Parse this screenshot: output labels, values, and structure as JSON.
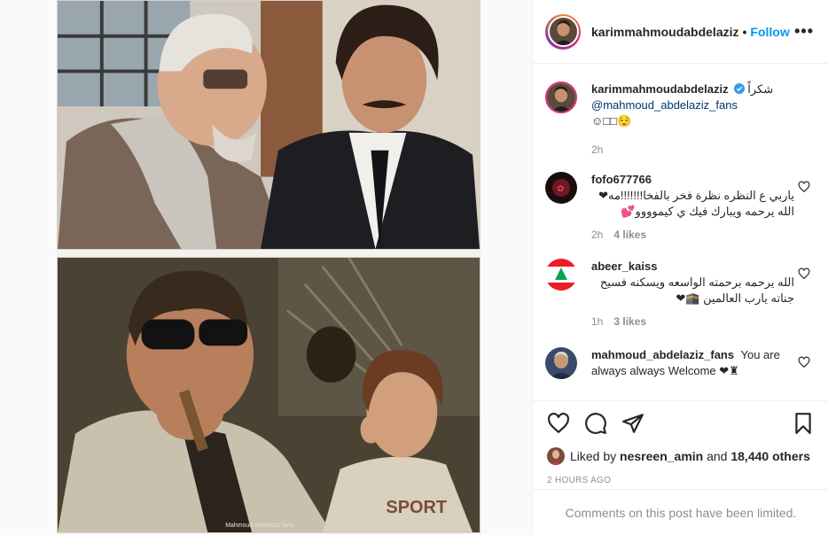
{
  "post": {
    "username": "karimmahmoudabdelaziz",
    "separator": "•",
    "follow_label": "Follow",
    "more_label": "•••",
    "caption": {
      "text": "شكراً",
      "mention": "@mahmoud_abdelaziz_fans",
      "emoji": "☺□□😌",
      "time": "2h"
    },
    "watermark": "Mahmoud abdelaziz fans"
  },
  "comments": [
    {
      "username": "fofo677766",
      "text": "ياربي ع النظره نظرة فخر بالفخا!!!!!!!مه❤الله يرحمه ويبارك فيك ي كيموووو💕",
      "time": "2h",
      "likes": "4 likes"
    },
    {
      "username": "abeer_kaiss",
      "text": "الله يرحمه برحمته الواسعه ويسكنه فسيح جناته يارب العالمين 🕋❤",
      "time": "1h",
      "likes": "3 likes"
    },
    {
      "username": "mahmoud_abdelaziz_fans",
      "text": "You are always always Welcome ❤♜",
      "time": "",
      "likes": ""
    }
  ],
  "likes": {
    "prefix": "Liked by",
    "user": "nesreen_amin",
    "conj": "and",
    "others": "18,440 others"
  },
  "timestamp": "2 HOURS AGO",
  "comments_limited": "Comments on this post have been limited.",
  "colors": {
    "link": "#0095f6",
    "text": "#262626",
    "muted": "#8e8e8e",
    "mention": "#00376b"
  },
  "icons": [
    "heart-icon",
    "comment-icon",
    "share-icon",
    "bookmark-icon",
    "verified-icon",
    "more-icon"
  ]
}
